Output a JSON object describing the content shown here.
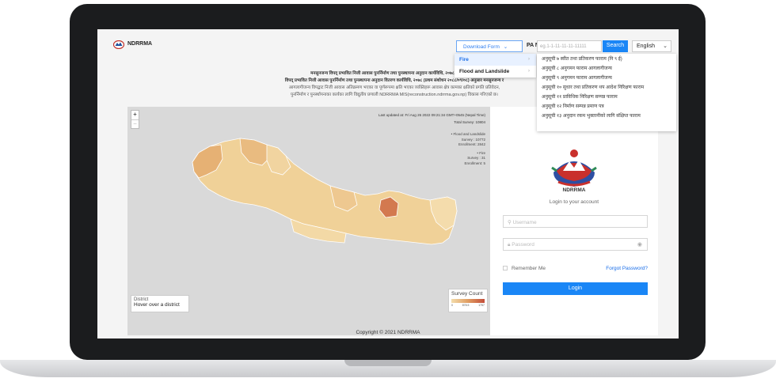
{
  "app": {
    "brand": "NDRRMA"
  },
  "header": {
    "download_label": "Download Form",
    "pa_label": "PA No",
    "pa_placeholder": "eg.1-1-11-11-11-11111",
    "search_label": "Search",
    "language": "English"
  },
  "download_menu": {
    "items": [
      {
        "label": "Fire",
        "active": true
      },
      {
        "label": "Flood and Landslide",
        "active": false
      }
    ],
    "submenu": [
      "अनुसूची ७ स्वीत तथा प्रतिकरण फाराम (नि ९ ई)",
      "अनुसूची ८ अनुगमन फाराम आगलागीजन्य",
      "अनुसूची ९ अनुगमन फाराम आगलागीजन्य",
      "अनुसूची १० सुधार तथा प्रतिकरण थप आदेश निरिक्षण फाराम",
      "अनुसूची ११ प्राविधिक निरिक्षण सम्पन्न फाराम",
      "अनुसूची १२ निर्माण सम्पन्न प्रमाण पत्र",
      "अनुसूची १३ अनुदान रकम भुक्तानीको लागि संक्षिप्त फाराम"
    ]
  },
  "notice": {
    "line1": "मनसुनजन्य विपद् प्रभावित निजी आवास पुनर्निर्माण तथा पुनस्थापना अनुदान कार्यविधि, २०७८ (प्रथम संशोधन",
    "line2": "विपद् प्रभावित निजी आवास पुनर्निर्माण तथा पुनस्थापना अनुदान वितरण कार्यविधि, २०७८ (प्रथम संशोधन २०८८/०९/०८) अनुसार मनसुनजन्य र",
    "line3": "आगलागीजन्य विपद्बाट निजी आवास अतिक्रमण भएका वा पूर्णरूपमा क्षति भएका व्यक्तिहरू आवास क्षेत्र कामका क्षतिको प्रगति प्रतिवेदन,",
    "line4": "पुनर्निर्माण र पुनर्स्थापनाका कार्यका लागि विद्युतीय प्रणाली NDRRMA MIS(reconstruction.ndrrma.gov.np) विकास गरिएको छ।"
  },
  "map": {
    "zoom_in": "+",
    "zoom_out": "−",
    "last_updated": "Last updated at: Fri Aug 26 2022 09:21:34 GMT+0545 (Nepal Time)",
    "total_survey": "Total Survey: 10804",
    "flood_title": "Flood and Landslide",
    "flood_survey": "Survey : 10772",
    "flood_enrollment": "Enrollment: 2842",
    "fire_title": "Fire",
    "fire_survey": "Survey : 31",
    "fire_enrollment": "Enrollment: 5",
    "district_title": "District",
    "district_value": "Hover over a district",
    "scale_title": "Survey Count",
    "scale_ticks": [
      "0",
      "878.5",
      "1757"
    ]
  },
  "login": {
    "org_name": "NDRRMA",
    "subtitle": "Login to your account",
    "username_placeholder": "Username",
    "password_placeholder": "Password",
    "remember_label": "Remember Me",
    "forgot_label": "Forgot Password?",
    "login_label": "Login"
  },
  "footer": {
    "copyright": "Copyright © 2021 NDRRMA"
  },
  "colors": {
    "primary": "#1a86f6",
    "link": "#1a6ee8",
    "map_low": "#f3dcab",
    "map_high": "#c44e3a"
  }
}
